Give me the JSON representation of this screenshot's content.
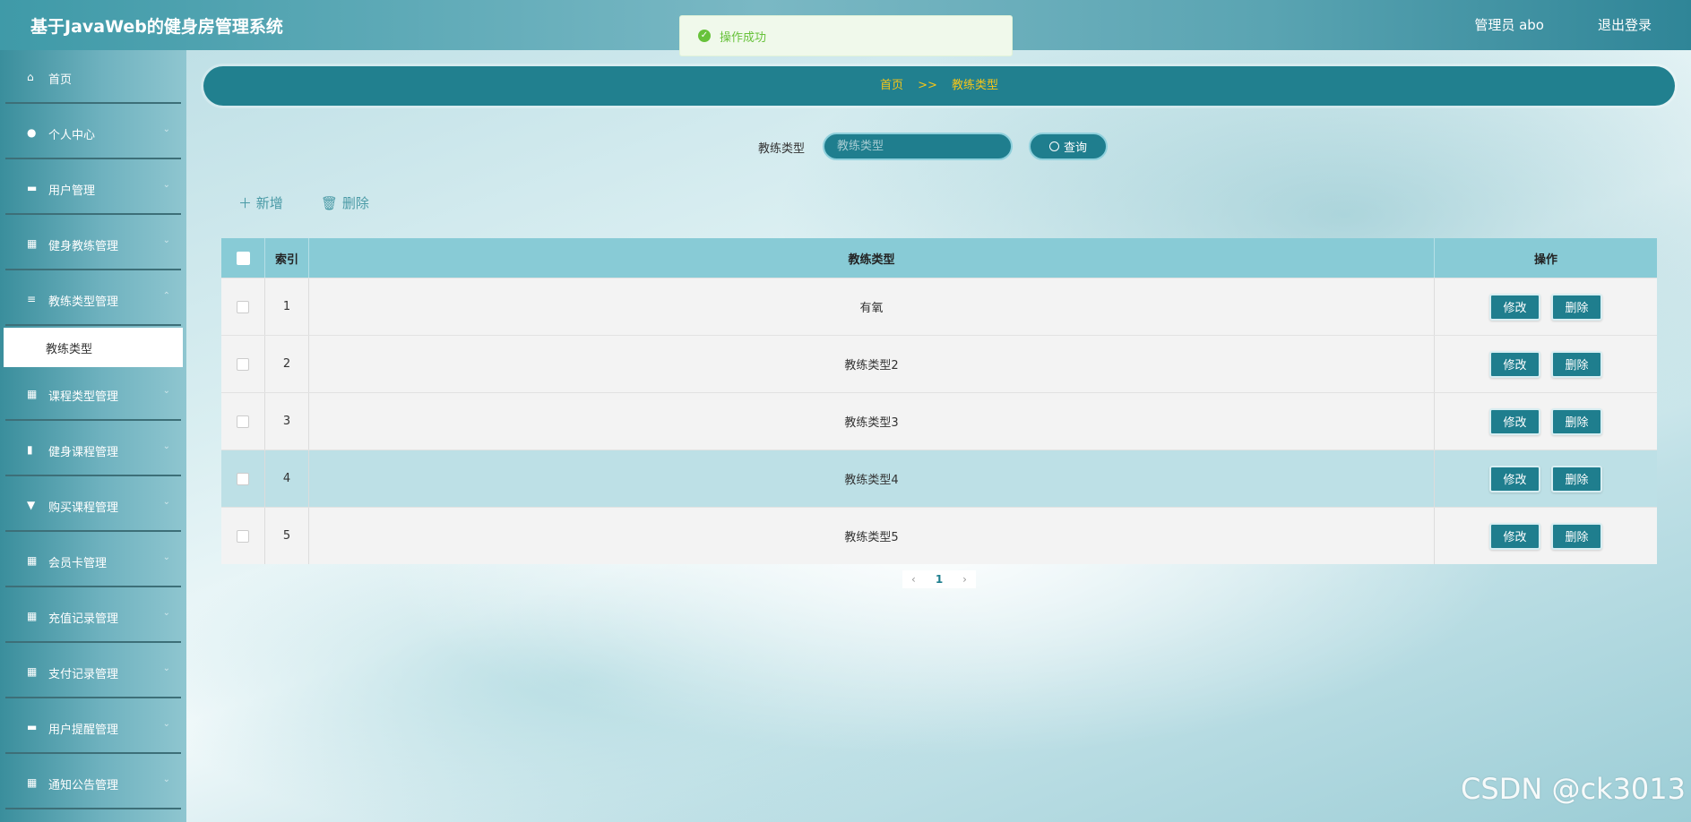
{
  "header": {
    "title": "基于JavaWeb的健身房管理系统",
    "user": "管理员 abo",
    "logout": "退出登录"
  },
  "toast": {
    "message": "操作成功"
  },
  "sidebar": {
    "items": [
      {
        "label": "首页",
        "icon": "home-icon"
      },
      {
        "label": "个人中心",
        "icon": "user-icon"
      },
      {
        "label": "用户管理",
        "icon": "monitor-icon"
      },
      {
        "label": "健身教练管理",
        "icon": "grid-icon"
      },
      {
        "label": "教练类型管理",
        "icon": "sliders-icon"
      },
      {
        "label": "课程类型管理",
        "icon": "grid-icon"
      },
      {
        "label": "健身课程管理",
        "icon": "bar-chart-icon"
      },
      {
        "label": "购买课程管理",
        "icon": "cart-icon"
      },
      {
        "label": "会员卡管理",
        "icon": "grid-icon"
      },
      {
        "label": "充值记录管理",
        "icon": "grid-icon"
      },
      {
        "label": "支付记录管理",
        "icon": "grid-icon"
      },
      {
        "label": "用户提醒管理",
        "icon": "message-icon"
      },
      {
        "label": "通知公告管理",
        "icon": "grid-icon"
      }
    ],
    "active_sub": "教练类型"
  },
  "breadcrumb": {
    "home": "首页",
    "sep": ">>",
    "current": "教练类型"
  },
  "search": {
    "label": "教练类型",
    "placeholder": "教练类型",
    "button": "查询"
  },
  "toolbar": {
    "add": "新增",
    "delete": "删除"
  },
  "table": {
    "headers": {
      "index": "索引",
      "type": "教练类型",
      "ops": "操作"
    },
    "edit_label": "修改",
    "delete_label": "删除",
    "rows": [
      {
        "index": "1",
        "type": "有氧"
      },
      {
        "index": "2",
        "type": "教练类型2"
      },
      {
        "index": "3",
        "type": "教练类型3"
      },
      {
        "index": "4",
        "type": "教练类型4"
      },
      {
        "index": "5",
        "type": "教练类型5"
      }
    ]
  },
  "pagination": {
    "current": "1",
    "prev": "‹",
    "next": "›"
  },
  "watermark": "CSDN @ck3013",
  "colors": {
    "primary": "#1f7e8e",
    "accent": "#f5c518",
    "success": "#67c23a"
  }
}
